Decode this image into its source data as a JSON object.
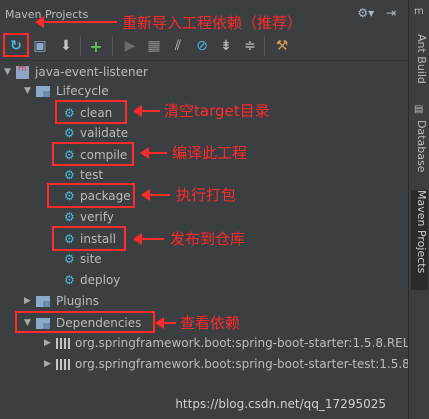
{
  "window": {
    "title": "Maven Projects"
  },
  "title_icons": [
    "gear-dropdown-icon",
    "hide-panel-icon"
  ],
  "toolbar": {
    "buttons": [
      "reimport-icon",
      "generate-sources-icon",
      "download-icon",
      "add-icon",
      "run-icon",
      "execute-goal-icon",
      "toggle-offline-icon",
      "skip-tests-icon",
      "collapse-all-icon",
      "show-dependencies-icon",
      "settings-icon"
    ]
  },
  "tree": {
    "project": "java-event-listener",
    "lifecycle": "Lifecycle",
    "phases": [
      "clean",
      "validate",
      "compile",
      "test",
      "package",
      "verify",
      "install",
      "site",
      "deploy"
    ],
    "plugins": "Plugins",
    "dependencies": "Dependencies",
    "deps": [
      "org.springframework.boot:spring-boot-starter:1.5.8.REL",
      "org.springframework.boot:spring-boot-starter-test:1.5.8"
    ]
  },
  "annotations": {
    "reimport": "重新导入工程依赖（推荐）",
    "clean": "清空target目录",
    "compile": "编译此工程",
    "package": "执行打包",
    "install": "发布到仓库",
    "dependencies": "查看依赖"
  },
  "side_tabs": [
    "Ant Build",
    "Database",
    "Maven Projects"
  ],
  "watermark": "https://blog.csdn.net/qq_17295025",
  "colors": {
    "background": "#3c3f41",
    "annotation": "#ff2a2a",
    "gear": "#4eb6d8"
  }
}
